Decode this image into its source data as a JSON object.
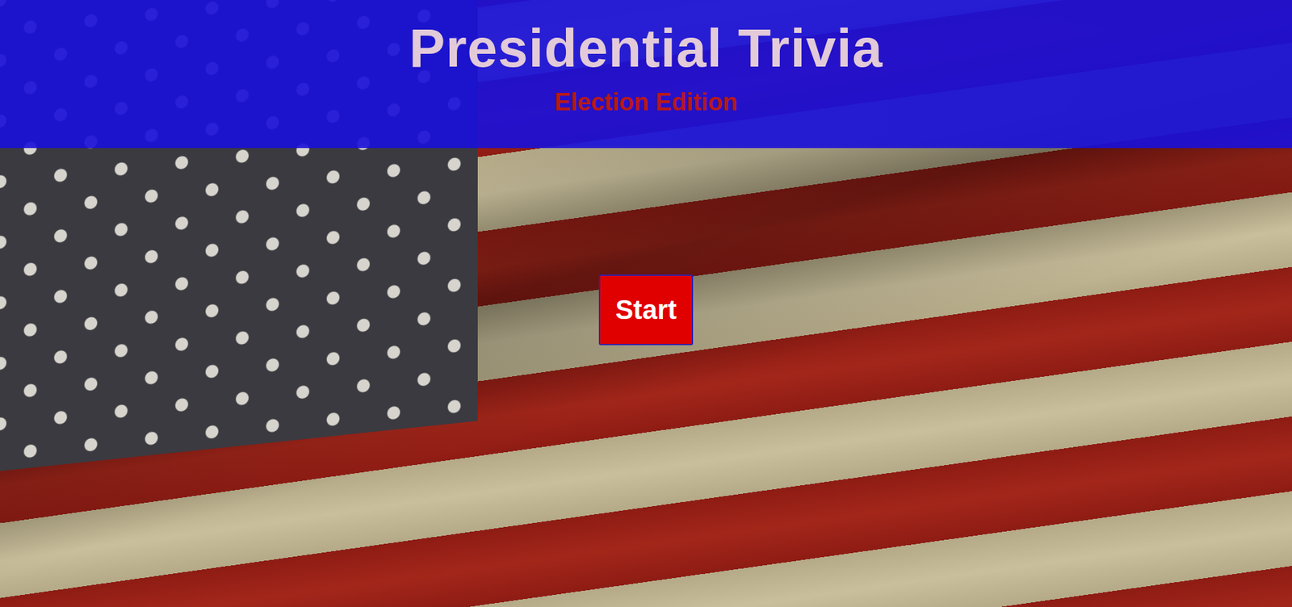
{
  "header": {
    "title": "Presidential Trivia",
    "subtitle": "Election Edition"
  },
  "start_button": {
    "label": "Start"
  }
}
